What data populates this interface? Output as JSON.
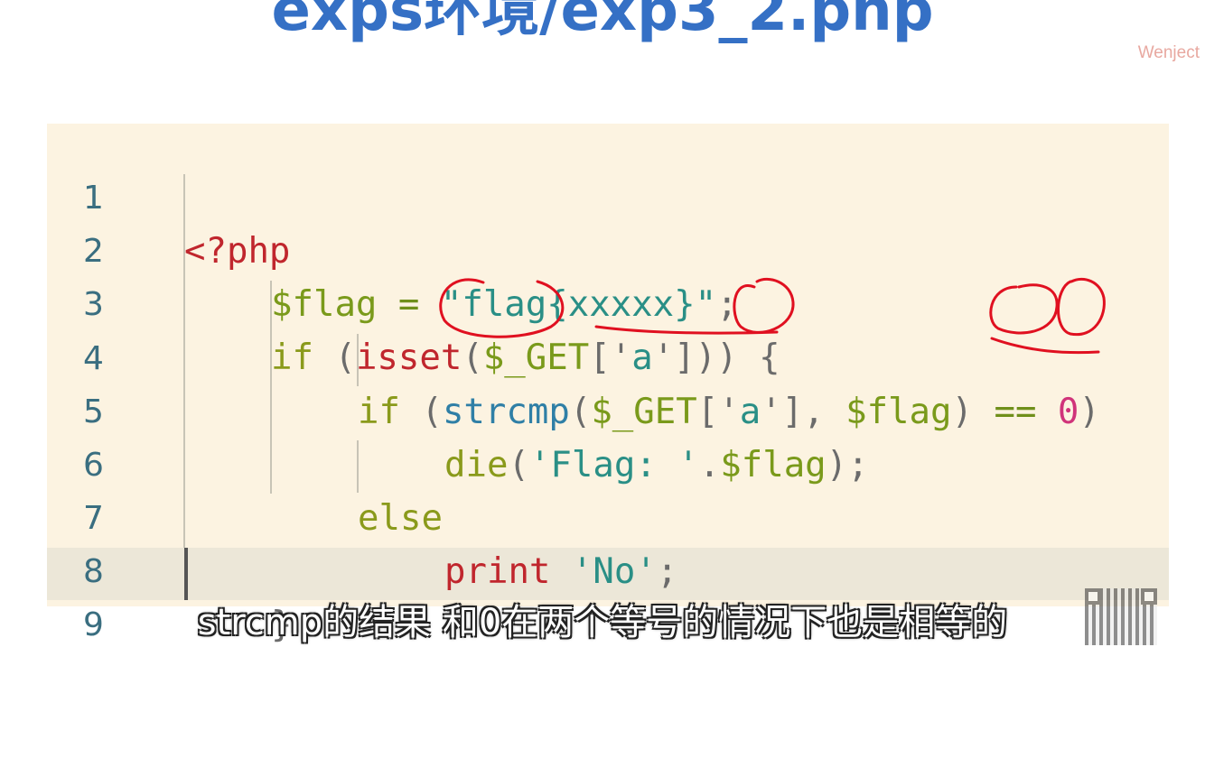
{
  "title": "exps环境/exp3_2.php",
  "watermark": "Wenject",
  "code": {
    "lines": [
      {
        "n": "1",
        "tokens": {
          "a": "<?php"
        }
      },
      {
        "n": "2",
        "tokens": {
          "a": "$flag",
          "b": " = ",
          "c": "\"flag{xxxxx}\"",
          "d": ";"
        }
      },
      {
        "n": "3",
        "tokens": {
          "a": "if",
          "b": " (",
          "c": "isset",
          "d": "(",
          "e": "$_GET",
          "f": "['",
          "g": "a",
          "h": "'])) {"
        }
      },
      {
        "n": "4",
        "tokens": {
          "a": "if",
          "b": " (",
          "c": "strcmp",
          "d": "(",
          "e": "$_GET",
          "f": "['",
          "g": "a",
          "h": "'], ",
          "i": "$flag",
          "j": ") ",
          "k": "==",
          "l": " ",
          "m": "0",
          "n": ")"
        }
      },
      {
        "n": "5",
        "tokens": {
          "a": "die",
          "b": "(",
          "c": "'Flag: '",
          "d": ".",
          "e": "$flag",
          "f": ");"
        }
      },
      {
        "n": "6",
        "tokens": {
          "a": "else"
        }
      },
      {
        "n": "7",
        "tokens": {
          "a": "print",
          "b": " ",
          "c": "'No'",
          "d": ";"
        }
      },
      {
        "n": "8",
        "tokens": {
          "a": "}"
        }
      },
      {
        "n": "9",
        "tokens": {
          "a": ""
        }
      }
    ]
  },
  "subtitle": "strcmp的结果 和0在两个等号的情况下也是相等的",
  "colors": {
    "title": "#3570c5",
    "panel_bg": "#fcf3e1",
    "annotation": "#e01020",
    "line_numbers": "#3a6e80"
  },
  "icons": {
    "qr_code": "qr-code-icon"
  }
}
